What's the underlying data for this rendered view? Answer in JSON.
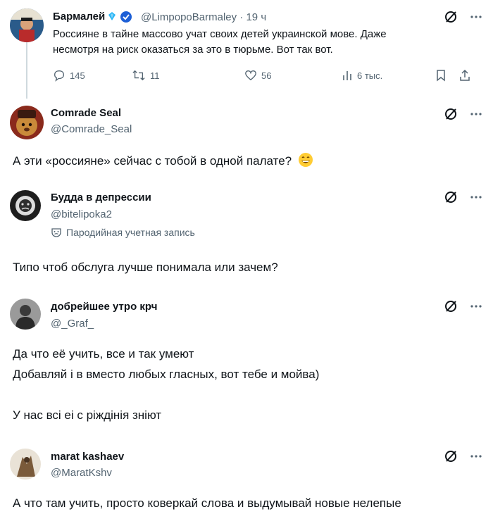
{
  "posts": [
    {
      "name": "Бармалей",
      "handle": "@LimpopoBarmaley",
      "time": "19 ч",
      "text_lines": [
        "Россияне в тайне массово учат своих детей украинской мове. Даже",
        "несмотря на риск оказаться за это в тюрьме. Вот так вот."
      ],
      "actions": {
        "replies": "145",
        "reposts": "11",
        "likes": "56",
        "views": "6 тыс."
      }
    },
    {
      "name": "Comrade Seal",
      "handle": "@Comrade_Seal",
      "text_lines": [
        "А эти «россияне» сейчас с тобой в одной палате?"
      ]
    },
    {
      "name": "Будда в депрессии",
      "handle": "@bitelipoka2",
      "parody_label": "Пародийная учетная запись",
      "text_lines": [
        "Типо чтоб обслуга лучше понимала или зачем?"
      ]
    },
    {
      "name": "добрейшее утро крч",
      "handle": "@_Graf_",
      "text_lines": [
        "Да что её учить, все и так умеют",
        "Добавляй і в вместо любых гласных, вот тебе и мойва)",
        "",
        "У нас всі еі с ріждінія зніют"
      ]
    },
    {
      "name": "marat kashaev",
      "handle": "@MaratKshv",
      "text_lines": [
        "А что там учить, просто коверкай слова и выдумывай новые нелепые"
      ]
    }
  ],
  "icons": {
    "grok": "grok-icon",
    "more": "more-icon",
    "reply": "reply-icon",
    "repost": "repost-icon",
    "like": "like-icon",
    "views": "views-icon",
    "bookmark": "bookmark-icon",
    "share": "share-icon"
  },
  "colors": {
    "text": "#0f1419",
    "secondary": "#536471",
    "verified_blue": "#1d9bf0",
    "thread_line": "#cfd9de"
  }
}
